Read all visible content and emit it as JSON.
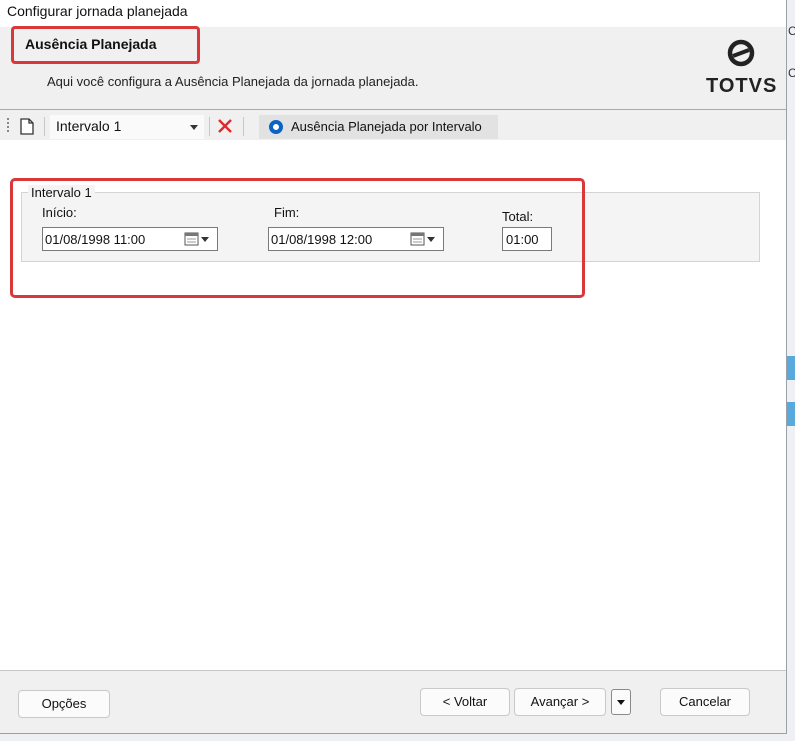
{
  "window": {
    "title": "Configurar jornada planejada"
  },
  "header": {
    "title": "Ausência Planejada",
    "subtitle": "Aqui você configura a Ausência Planejada da jornada planejada.",
    "logo_text": "TOTVS"
  },
  "toolbar": {
    "interval_selected": "Intervalo 1",
    "radio_label": "Ausência Planejada por Intervalo",
    "icons": [
      "new-document-icon",
      "delete-x-icon"
    ]
  },
  "interval": {
    "group_label": "Intervalo 1",
    "start_label": "Início:",
    "start_value": "01/08/1998 11:00",
    "end_label": "Fim:",
    "end_value": "01/08/1998 12:00",
    "total_label": "Total:",
    "total_value": "01:00"
  },
  "footer": {
    "options_label": "Opções",
    "back_label": "< Voltar",
    "next_label": "Avançar >",
    "cancel_label": "Cancelar"
  },
  "colors": {
    "highlight": "#d9373a",
    "radio": "#0b63c4",
    "accent": "#5aa9dd"
  }
}
